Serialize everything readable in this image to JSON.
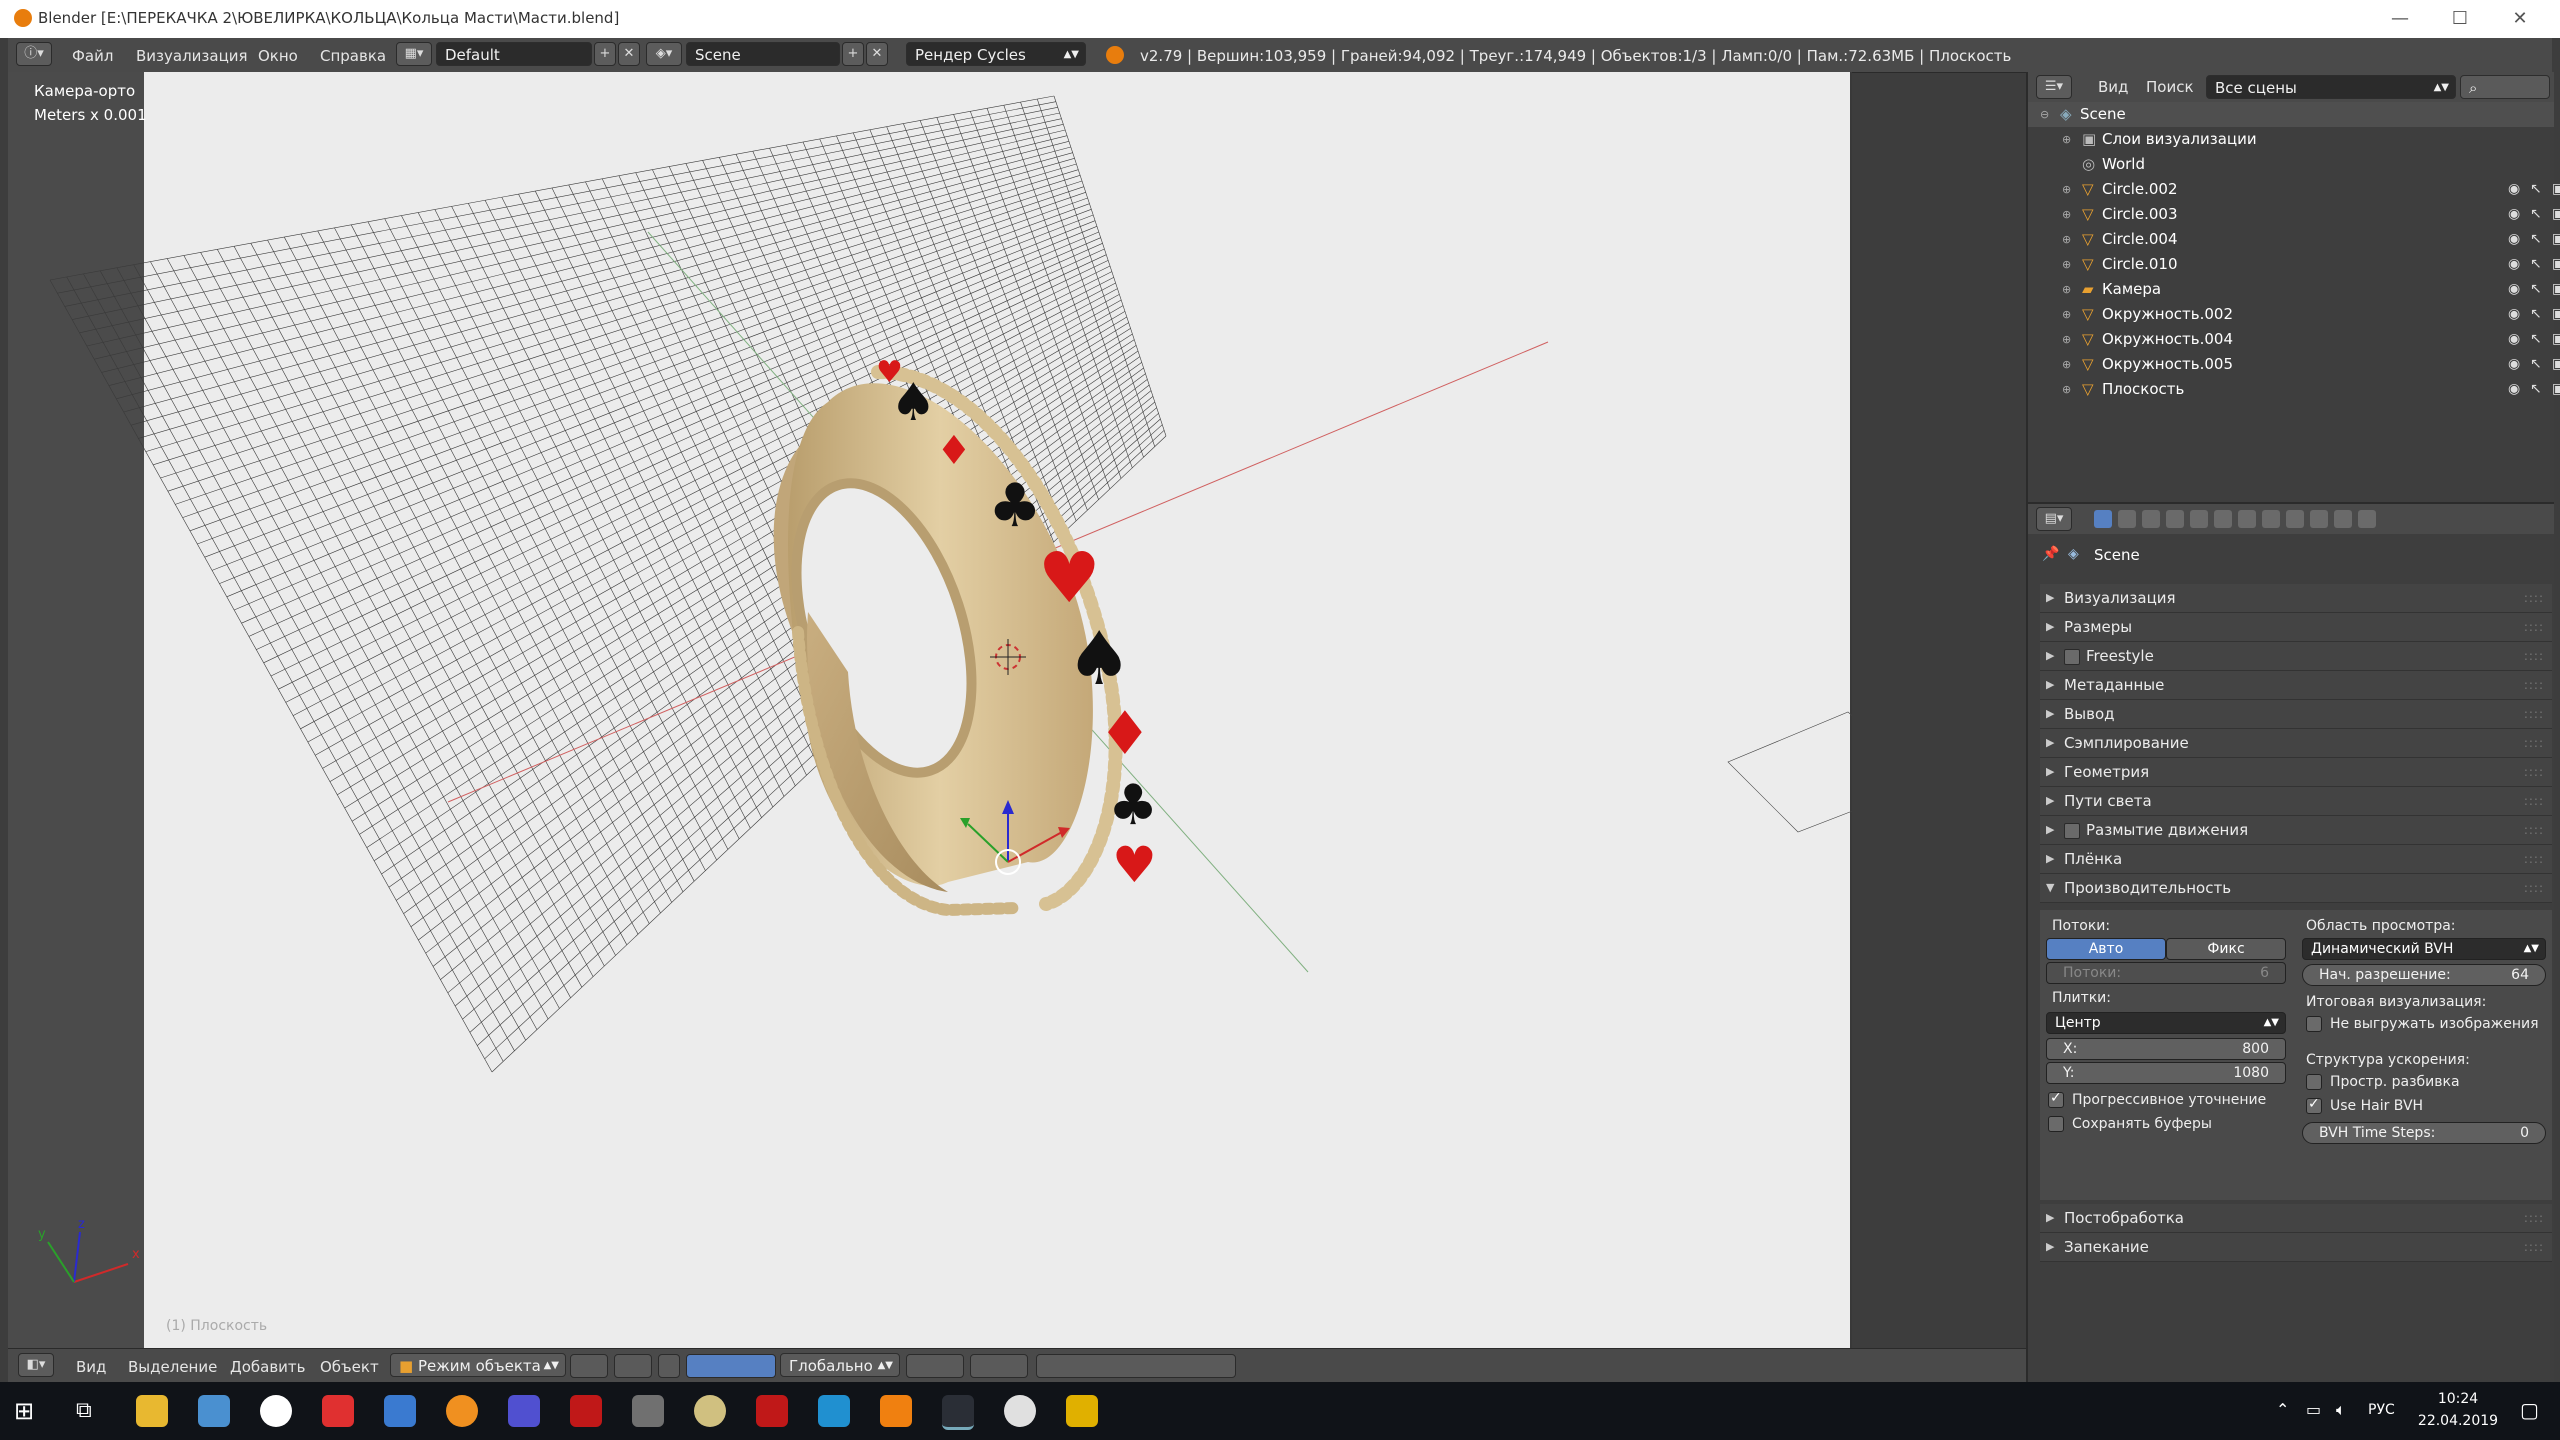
{
  "window": {
    "title": "Blender [E:\\ПЕРЕКАЧКА 2\\ЮВЕЛИРКА\\КОЛЬЦА\\Кольца Масти\\Масти.blend]",
    "controls": [
      "—",
      "☐",
      "✕"
    ]
  },
  "infobar": {
    "menus": [
      "Файл",
      "Визуализация",
      "Окно",
      "Справка"
    ],
    "layout": "Default",
    "scene": "Scene",
    "engine": "Рендер Cycles",
    "stats": "v2.79 | Вершин:103,959 | Граней:94,092 | Треуг.:174,949 | Объектов:1/3 | Ламп:0/0 | Пам.:72.63МБ | Плоскость"
  },
  "viewport": {
    "view_name": "Камера-орто",
    "units": "Meters x 0.001",
    "object_label": "(1) Плоскость",
    "axis_labels": {
      "x": "x",
      "y": "y",
      "z": "z"
    }
  },
  "viewport_footer": {
    "menus": [
      "Вид",
      "Выделение",
      "Добавить",
      "Объект"
    ],
    "mode": "Режим объекта",
    "orientation": "Глобально"
  },
  "outliner": {
    "menus": [
      "Вид",
      "Поиск"
    ],
    "filter": "Все сцены",
    "items": [
      {
        "label": "Scene",
        "level": 0,
        "type": "scene"
      },
      {
        "label": "Слои визуализации",
        "level": 1,
        "type": "renderlayers"
      },
      {
        "label": "World",
        "level": 1,
        "type": "world"
      },
      {
        "label": "Circle.002",
        "level": 1,
        "type": "mesh"
      },
      {
        "label": "Circle.003",
        "level": 1,
        "type": "mesh"
      },
      {
        "label": "Circle.004",
        "level": 1,
        "type": "mesh"
      },
      {
        "label": "Circle.010",
        "level": 1,
        "type": "mesh"
      },
      {
        "label": "Камера",
        "level": 1,
        "type": "camera"
      },
      {
        "label": "Окружность.002",
        "level": 1,
        "type": "mesh"
      },
      {
        "label": "Окружность.004",
        "level": 1,
        "type": "mesh"
      },
      {
        "label": "Окружность.005",
        "level": 1,
        "type": "mesh"
      },
      {
        "label": "Плоскость",
        "level": 1,
        "type": "mesh"
      }
    ]
  },
  "properties": {
    "context": "Scene",
    "panels": [
      "Визуализация",
      "Размеры",
      "Freestyle",
      "Метаданные",
      "Вывод",
      "Сэмплирование",
      "Геометрия",
      "Пути света",
      "Размытие движения",
      "Плёнка",
      "Производительность",
      "Постобработка",
      "Запекание"
    ],
    "performance": {
      "threads_label": "Потоки:",
      "threads_auto": "Авто",
      "threads_fixed": "Фикс",
      "threads_field": "Потоки:",
      "threads_value": "6",
      "tiles_label": "Плитки:",
      "tile_order": "Центр",
      "x_label": "X:",
      "x_value": "800",
      "y_label": "Y:",
      "y_value": "1080",
      "progressive": "Прогрессивное уточнение",
      "save_buffers": "Сохранять буферы",
      "viewport_label": "Область просмотра:",
      "bvh_type": "Динамический BVH",
      "start_res_label": "Нач. разрешение:",
      "start_res_value": "64",
      "final_label": "Итоговая визуализация:",
      "no_unload": "Не выгружать изображения",
      "accel_label": "Структура ускорения:",
      "spatial_split": "Простр. разбивка",
      "use_hair_bvh": "Use Hair BVH",
      "bvh_steps_label": "BVH Time Steps:",
      "bvh_steps_value": "0"
    }
  },
  "taskbar": {
    "language": "РУС",
    "time": "10:24",
    "date": "22.04.2019"
  },
  "colors": {
    "ring": "#d9c49a",
    "red_suit": "#d81818",
    "black_suit": "#101010",
    "blue_button": "#5680c2"
  }
}
